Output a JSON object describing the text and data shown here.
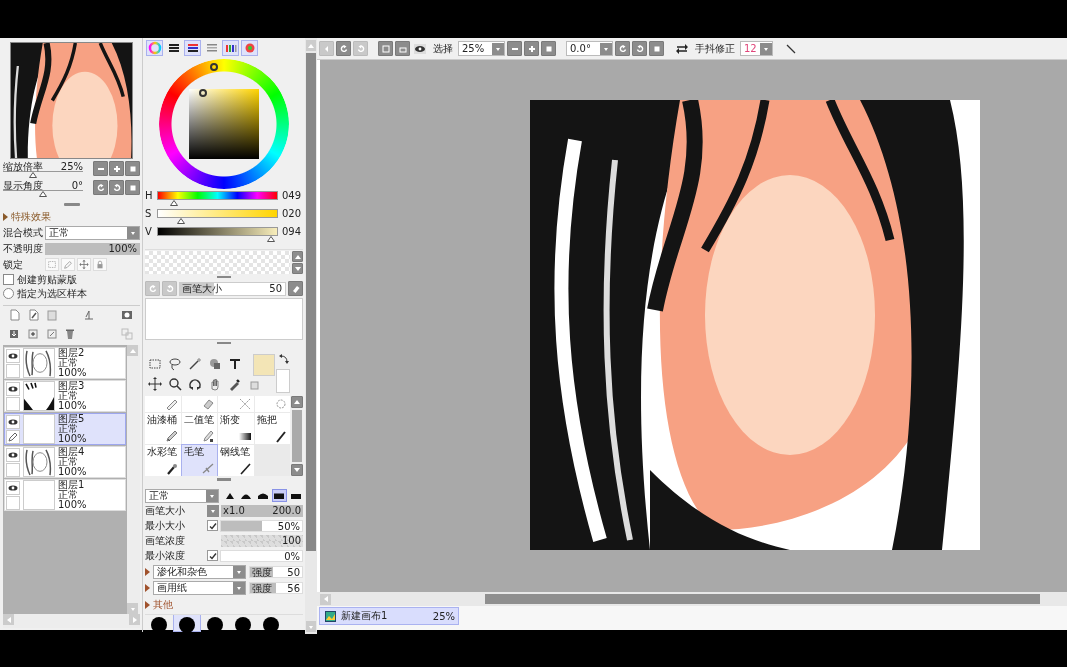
{
  "navigator": {
    "zoom": {
      "label": "缩放倍率",
      "value": "25%",
      "level": 0.37
    },
    "angle": {
      "label": "显示角度",
      "value": "0°",
      "level": 0.5
    }
  },
  "effects_header": "特殊效果",
  "layer_props": {
    "blend_label": "混合模式",
    "blend_value": "正常",
    "opacity": {
      "label": "不透明度",
      "value": "100%",
      "level": 1
    },
    "lock_label": "锁定",
    "clip": {
      "label": "创建剪贴蒙版",
      "checked": false
    },
    "sample": {
      "label": "指定为选区样本",
      "selected": false
    }
  },
  "layers": [
    {
      "name": "图层2",
      "mode": "正常",
      "opacity": "100%",
      "kind": "picture",
      "selected": false,
      "editing": false
    },
    {
      "name": "图层3",
      "mode": "正常",
      "opacity": "100%",
      "kind": "picture",
      "selected": false,
      "editing": false
    },
    {
      "name": "图层5",
      "mode": "正常",
      "opacity": "100%",
      "kind": "blank",
      "selected": true,
      "editing": true
    },
    {
      "name": "图层4",
      "mode": "正常",
      "opacity": "100%",
      "kind": "picture",
      "selected": false,
      "editing": false
    },
    {
      "name": "图层1",
      "mode": "正常",
      "opacity": "100%",
      "kind": "blank",
      "selected": false,
      "editing": false
    }
  ],
  "color_modes": [
    {
      "selected": true
    },
    {
      "selected": false
    },
    {
      "selected": true
    },
    {
      "selected": false
    },
    {
      "selected": true
    },
    {
      "selected": true
    }
  ],
  "color_sliders": [
    {
      "label": "H",
      "value": "049",
      "level": 0.14
    },
    {
      "label": "S",
      "value": "020",
      "level": 0.2
    },
    {
      "label": "V",
      "value": "094",
      "level": 0.94
    }
  ],
  "brush_size_bar": {
    "label": "画笔大小",
    "value": "50",
    "level": 0.32
  },
  "brushes": [
    {
      "label": "油漆桶",
      "selected": false
    },
    {
      "label": "二值笔",
      "selected": false
    },
    {
      "label": "渐变",
      "selected": false
    },
    {
      "label": "拖把",
      "selected": false
    },
    {
      "label": "水彩笔",
      "selected": false
    },
    {
      "label": "毛笔",
      "selected": true
    },
    {
      "label": "钢线笔",
      "selected": false
    }
  ],
  "brush_settings": {
    "blend": "正常",
    "shapes": [
      {
        "selected": false
      },
      {
        "selected": false
      },
      {
        "selected": false
      },
      {
        "selected": true
      },
      {
        "selected": false
      }
    ],
    "rows": [
      {
        "kind": "scaled",
        "label": "画笔大小",
        "factor": "x1.0",
        "value": "200.0",
        "level": 1
      },
      {
        "kind": "check",
        "label": "最小大小",
        "checked": true,
        "value": "50%",
        "level": 0.5
      },
      {
        "kind": "pattern",
        "label": "画笔浓度",
        "value": "100",
        "level": 1
      },
      {
        "kind": "check",
        "label": "最小浓度",
        "checked": true,
        "value": "0%",
        "level": 0
      }
    ],
    "textures": [
      {
        "name": "渗化和杂色",
        "strength_label": "强度",
        "value": "50",
        "level": 0.45
      },
      {
        "name": "画用纸",
        "strength_label": "强度",
        "value": "56",
        "level": 0.5
      }
    ],
    "other": "其他",
    "tips": [
      {
        "selected": false
      },
      {
        "selected": true
      },
      {
        "selected": false
      },
      {
        "selected": false
      },
      {
        "selected": false
      }
    ]
  },
  "toolbar": {
    "select_label": "选择",
    "zoom": "25%",
    "angle": "0.0°",
    "stabilizer_label": "手抖修正",
    "stabilizer": "12"
  },
  "canvas_tabs": [
    {
      "name": "新建画布1",
      "zoom": "25%",
      "selected": true
    }
  ]
}
